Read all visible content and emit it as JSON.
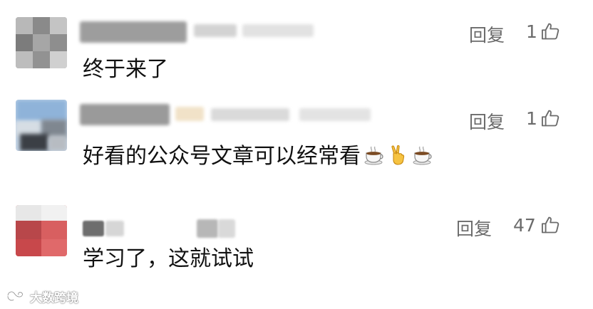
{
  "comments": [
    {
      "text": "终于来了",
      "reply_label": "回复",
      "likes": "1"
    },
    {
      "text": "好看的公众号文章可以经常看",
      "emojis": [
        "hot-beverage-emoji",
        "victory-hand-emoji",
        "hot-beverage-emoji"
      ],
      "reply_label": "回复",
      "likes": "1"
    },
    {
      "text": "学习了，这就试试",
      "reply_label": "回复",
      "likes": "47"
    }
  ],
  "watermark": {
    "text": "大数跨境"
  },
  "colors": {
    "secondary_text": "#6b6b6b",
    "primary_text": "#111111"
  }
}
